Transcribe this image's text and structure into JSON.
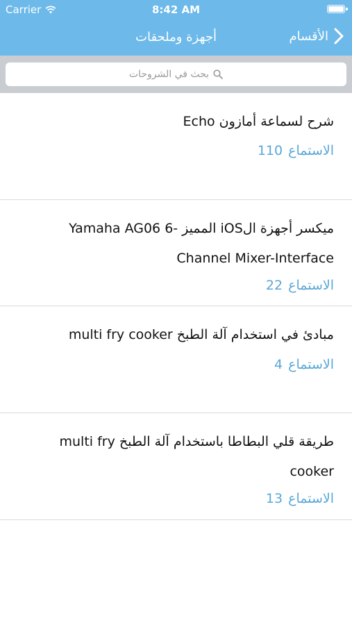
{
  "status_bar": {
    "carrier": "Carrier",
    "time": "8:42 AM"
  },
  "nav": {
    "title": "أجهزة وملحقات",
    "back_label": "الأقسام"
  },
  "search": {
    "placeholder": "بحث في الشروحات"
  },
  "list": {
    "items": [
      {
        "title": "شرح لسماعة أمازون Echo",
        "count_label": "الاستماع",
        "count": "110"
      },
      {
        "title": "ميكسر أجهزة الiOS المميز -Yamaha AG06 6 Channel Mixer-Interface",
        "count_label": "الاستماع",
        "count": "22"
      },
      {
        "title": "مبادئ في استخدام آلة الطبخ multi fry cooker",
        "count_label": "الاستماع",
        "count": "4"
      },
      {
        "title": "طريقة قلي البطاطا باستخدام آلة الطبخ multi fry cooker",
        "count_label": "الاستماع",
        "count": "13"
      }
    ]
  },
  "colors": {
    "accent": "#6cb9ea",
    "count": "#5aa7d6",
    "search_bg": "#c9ccd1"
  }
}
